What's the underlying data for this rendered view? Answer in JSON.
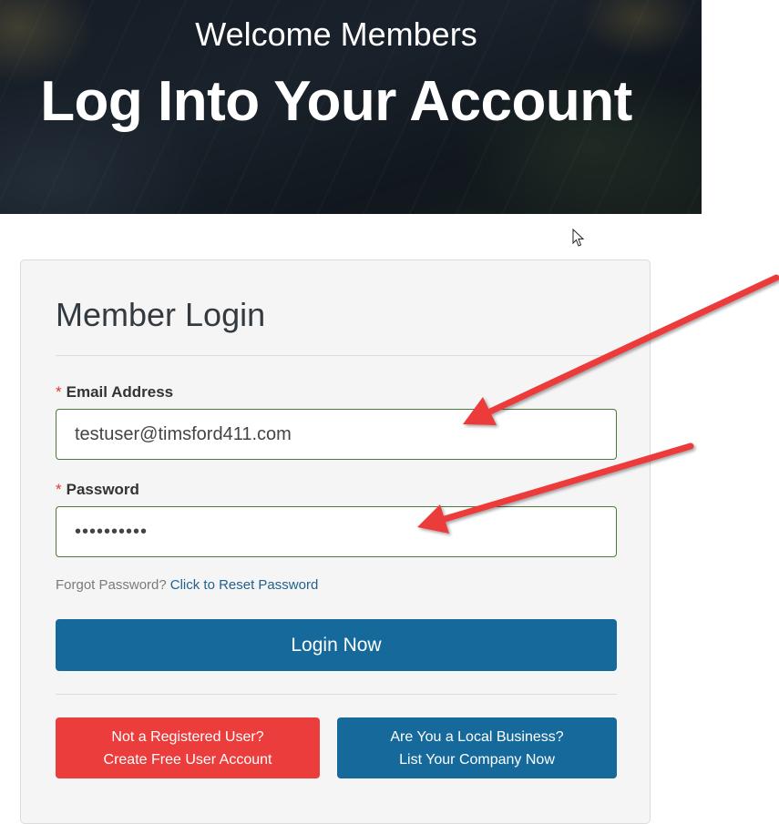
{
  "hero": {
    "subtitle": "Welcome Members",
    "title": "Log Into Your Account"
  },
  "login": {
    "heading": "Member Login",
    "email": {
      "label": "Email Address",
      "required_mark": "*",
      "value": "testuser@timsford411.com"
    },
    "password": {
      "label": "Password",
      "required_mark": "*",
      "value": "••••••••••"
    },
    "forgot": {
      "prompt": "Forgot Password?",
      "link": "Click to Reset Password"
    },
    "submit_label": "Login Now",
    "register": {
      "line1": "Not a Registered User?",
      "line2": "Create Free User Account"
    },
    "business": {
      "line1": "Are You a Local Business?",
      "line2": "List Your Company Now"
    }
  },
  "colors": {
    "primary": "#156a9b",
    "danger": "#ec3d3d",
    "field_border": "#4b7b3a",
    "annotation_arrow": "#ec3b3b"
  },
  "icons": [
    "mouse-cursor-icon",
    "annotation-arrow"
  ]
}
